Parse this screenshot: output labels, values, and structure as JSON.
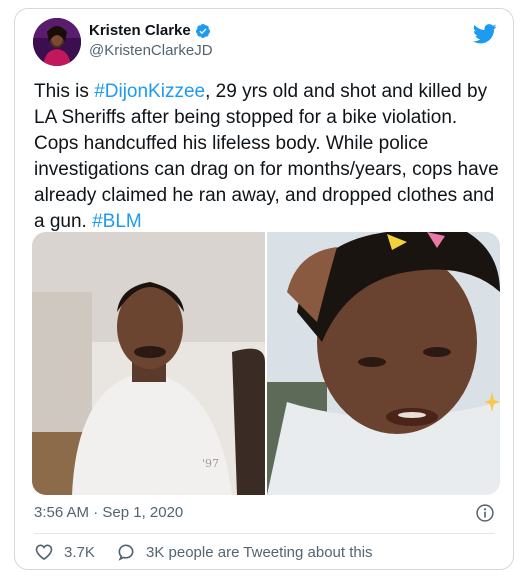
{
  "author": {
    "display_name": "Kristen Clarke",
    "handle": "@KristenClarkeJD",
    "verified": true
  },
  "tweet": {
    "segments": [
      {
        "type": "text",
        "text": "This is "
      },
      {
        "type": "hashtag",
        "text": "#DijonKizzee"
      },
      {
        "type": "text",
        "text": ", 29 yrs old and shot and killed by LA Sheriffs after being stopped for a bike violation. Cops handcuffed his lifeless body. While police investigations can drag on for months/years, cops have already claimed he ran away, and dropped clothes and a gun. "
      },
      {
        "type": "hashtag",
        "text": "#BLM"
      }
    ]
  },
  "timestamp": "3:56 AM · Sep 1, 2020",
  "actions": {
    "likes": "3.7K",
    "tweeting": "3K people are Tweeting about this"
  },
  "colors": {
    "accent": "#1d9bf0",
    "text": "#0f1419",
    "muted": "#536471",
    "border": "#cfd9de"
  },
  "icons": {
    "logo": "twitter-bird-icon",
    "verified": "verified-badge-icon",
    "info": "info-icon",
    "like": "heart-icon",
    "tweeting": "speech-bubble-icon"
  }
}
